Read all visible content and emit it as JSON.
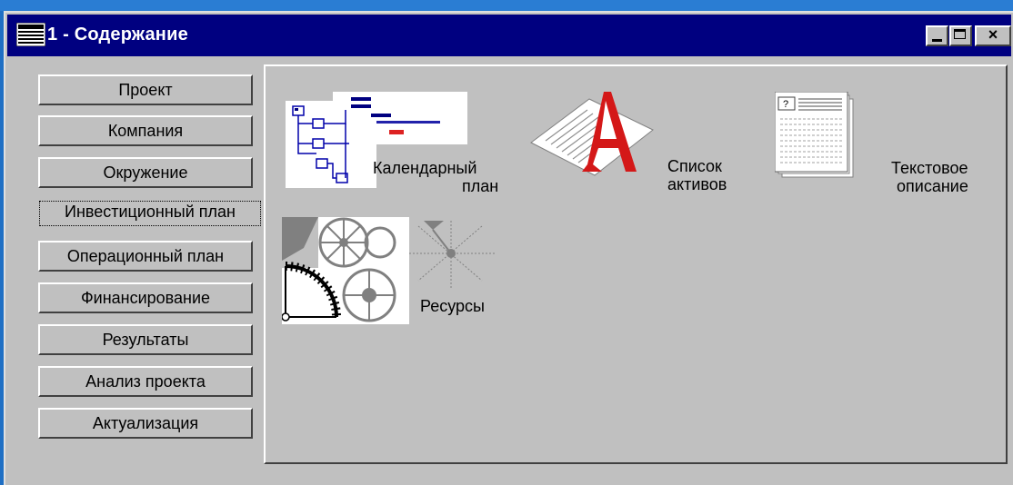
{
  "window": {
    "title": "1 - Содержание",
    "close_glyph": "×"
  },
  "nav": {
    "items": [
      {
        "label": "Проект"
      },
      {
        "label": "Компания"
      },
      {
        "label": "Окружение"
      },
      {
        "label": "Инвестиционный план",
        "active": true
      },
      {
        "label": "Операционный план"
      },
      {
        "label": "Финансирование"
      },
      {
        "label": "Результаты"
      },
      {
        "label": "Анализ проекта"
      },
      {
        "label": "Актуализация"
      }
    ]
  },
  "items": {
    "calendar": {
      "line1": "Календарный",
      "line2": "план",
      "icon": "gantt-chart-icon"
    },
    "assets": {
      "line1": "Список",
      "line2": "активов",
      "icon": "letter-a-document-icon"
    },
    "description": {
      "line1": "Текстовое",
      "line2": "описание",
      "icon": "text-document-icon"
    },
    "resources": {
      "line1": "Ресурсы",
      "icon": "gears-icon"
    }
  },
  "colors": {
    "titlebar": "#000080",
    "face": "#c0c0c0",
    "desktop": "#1f6fc4",
    "accent_red": "#cc1111"
  }
}
